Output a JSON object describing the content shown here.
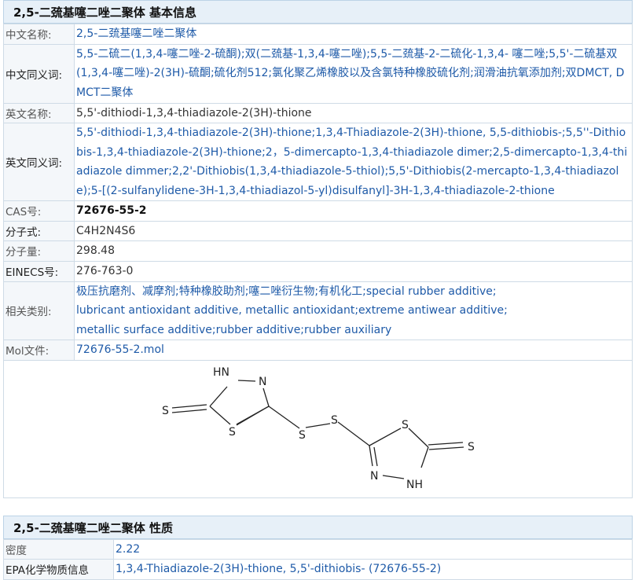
{
  "section1": {
    "title": "2,5-二巯基噻二唑二聚体 基本信息",
    "rows": [
      {
        "label": "中文名称:",
        "value": "2,5-二巯基噻二唑二聚体"
      },
      {
        "label": "中文同义词:",
        "value": "5,5-二硫二(1,3,4-噻二唑-2-硫酮);双(二巯基-1,3,4-噻二唑);5,5-二巯基-2-二硫化-1,3,4- 噻二唑;5,5'-二硫基双(1,3,4-噻二唑)-2(3H)-硫酮;硫化剂512;氯化聚乙烯橡胶以及含氯特种橡胶硫化剂;润滑油抗氧添加剂;双DMCT, DMCT二聚体"
      },
      {
        "label": "英文名称:",
        "value": "5,5'-dithiodi-1,3,4-thiadiazole-2(3H)-thione"
      },
      {
        "label": "英文同义词:",
        "value": "5,5'-dithiodi-1,3,4-thiadiazole-2(3H)-thione;1,3,4-Thiadiazole-2(3H)-thione, 5,5-dithiobis-;5,5''-Dithiobis-1,3,4-thiadiazole-2(3H)-thione;2，5-dimercapto-1,3,4-thiadiazole dimer;2,5-dimercapto-1,3,4-thiadiazole dimmer;2,2'-Dithiobis(1,3,4-thiadiazole-5-thiol);5,5'-Dithiobis(2-mercapto-1,3,4-thiadiazole);5-[(2-sulfanylidene-3H-1,3,4-thiadiazol-5-yl)disulfanyl]-3H-1,3,4-thiadiazole-2-thione"
      },
      {
        "label": "CAS号:",
        "value": "72676-55-2"
      },
      {
        "label": "分子式:",
        "value": "C4H2N4S6"
      },
      {
        "label": "分子量:",
        "value": "298.48"
      },
      {
        "label": "EINECS号:",
        "value": "276-763-0"
      },
      {
        "label": "相关类别:",
        "lines": [
          "极压抗磨剂、减摩剂;特种橡胶助剂;噻二唑衍生物;有机化工;special rubber additive;",
          "lubricant antioxidant additive, metallic antioxidant;extreme antiwear additive;",
          "metallic surface additive;rubber additive;rubber auxiliary"
        ]
      },
      {
        "label": "Mol文件:",
        "value": "72676-55-2.mol"
      }
    ],
    "structure_atoms": {
      "hn": "HN",
      "n": "N",
      "s_exo_left": "S",
      "s_ring_left": "S",
      "s_link_left": "S",
      "s_link_right": "S",
      "s_ring_right": "S",
      "s_exo_right": "S",
      "n_right": "N",
      "nh": "NH"
    }
  },
  "section2": {
    "title": "2,5-二巯基噻二唑二聚体 性质",
    "rows": [
      {
        "label": "密度",
        "value": "2.22"
      },
      {
        "label": "EPA化学物质信息",
        "value": "1,3,4-Thiadiazole-2(3H)-thione, 5,5'-dithiobis- (72676-55-2)"
      }
    ]
  }
}
